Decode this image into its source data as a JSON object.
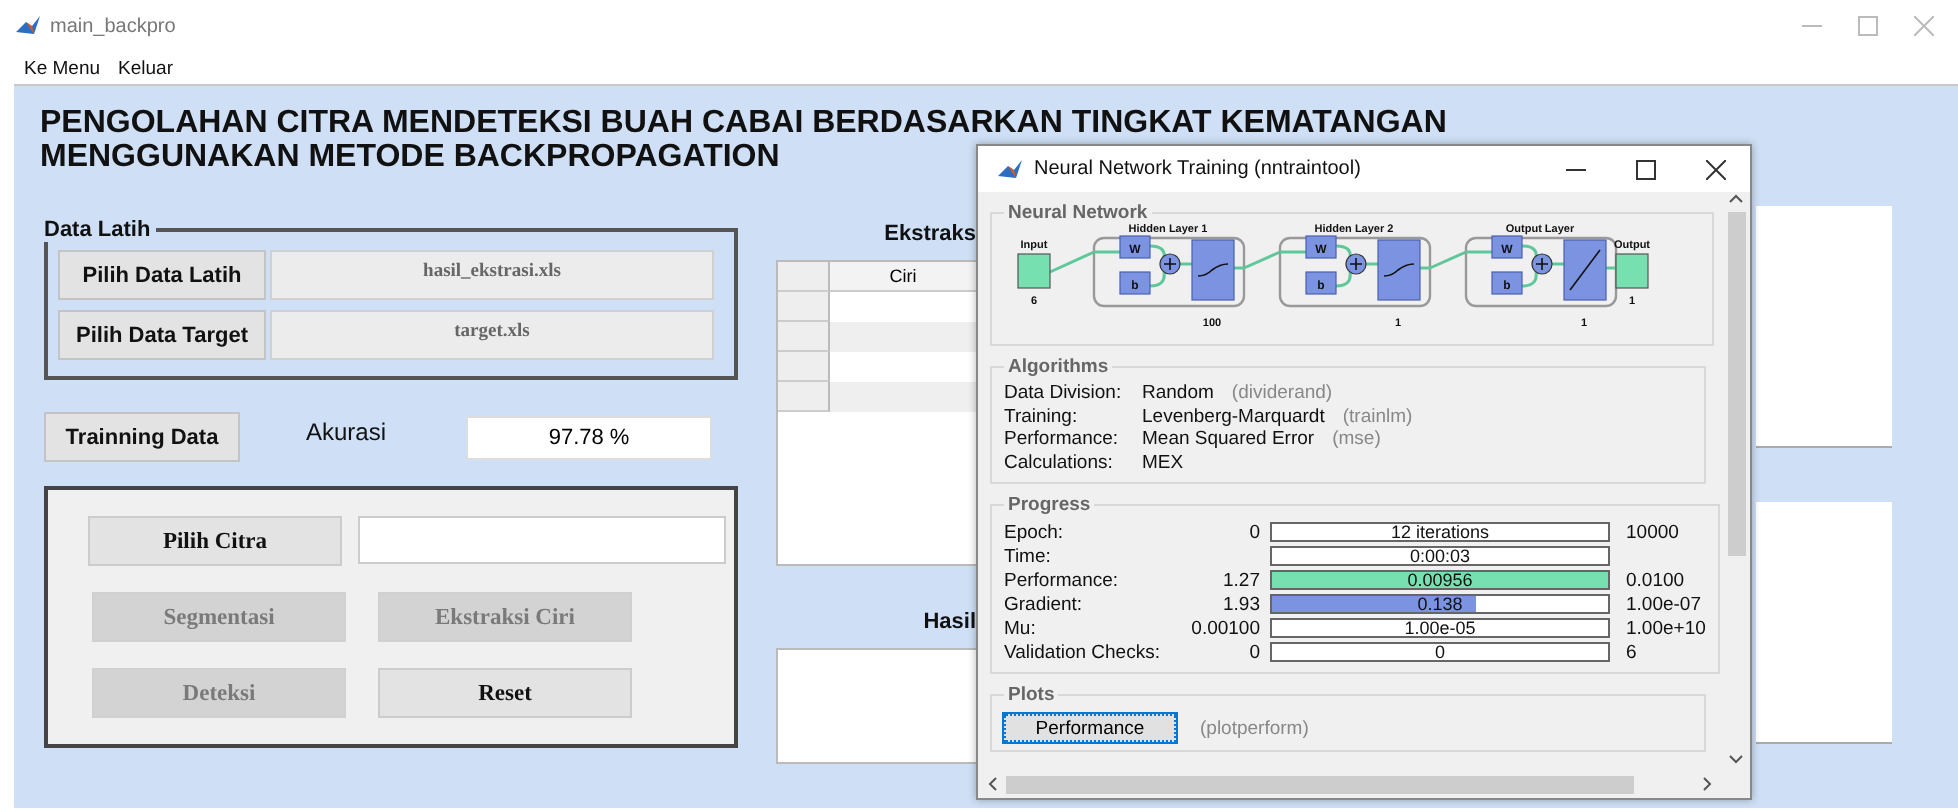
{
  "window": {
    "title": "main_backpro"
  },
  "menu": [
    "Ke Menu",
    "Keluar"
  ],
  "heading_lines": [
    "PENGOLAHAN CITRA MENDETEKSI BUAH CABAI BERDASARKAN TINGKAT KEMATANGAN",
    "MENGGUNAKAN METODE BACKPROPAGATION"
  ],
  "data_latih": {
    "title": "Data Latih",
    "rows": [
      {
        "button": "Pilih Data Latih",
        "value": "hasil_ekstrasi.xls"
      },
      {
        "button": "Pilih Data Target",
        "value": "target.xls"
      }
    ]
  },
  "training": {
    "button": "Trainning Data",
    "label": "Akurasi",
    "value": "97.78 %"
  },
  "image_panel": {
    "button": "Pilih Citra",
    "actions": [
      {
        "label": "Segmentasi",
        "disabled": true
      },
      {
        "label": "Ekstraksi Ciri",
        "disabled": true
      },
      {
        "label": "Deteksi",
        "disabled": true
      },
      {
        "label": "Reset",
        "disabled": false
      }
    ]
  },
  "feature_table": {
    "title": "Ekstraks",
    "columns": [
      "Ciri"
    ]
  },
  "result": {
    "title": "Hasil"
  },
  "dialog": {
    "title": "Neural Network Training (nntraintool)",
    "network": {
      "title": "Neural Network",
      "input": {
        "label": "Input",
        "size": "6"
      },
      "output": {
        "label": "Output",
        "size": "1"
      },
      "layers": [
        {
          "title": "Hidden Layer 1",
          "size": "100",
          "weight": "W",
          "bias": "b",
          "kind": "sigmoid"
        },
        {
          "title": "Hidden Layer 2",
          "size": "1",
          "weight": "W",
          "bias": "b",
          "kind": "sigmoid"
        },
        {
          "title": "Output Layer",
          "size": "1",
          "weight": "W",
          "bias": "b",
          "kind": "linear"
        }
      ]
    },
    "algorithms": {
      "title": "Algorithms",
      "rows": [
        {
          "label": "Data Division:",
          "value": "Random",
          "fn": "(dividerand)"
        },
        {
          "label": "Training:",
          "value": "Levenberg-Marquardt",
          "fn": "(trainlm)"
        },
        {
          "label": "Performance:",
          "value": "Mean Squared Error",
          "fn": "(mse)"
        },
        {
          "label": "Calculations:",
          "value": "MEX"
        }
      ]
    },
    "progress": {
      "title": "Progress",
      "rows": [
        {
          "label": "Epoch:",
          "start": "0",
          "bar": "12 iterations",
          "end": "10000"
        },
        {
          "label": "Time:",
          "bar": "0:00:03"
        },
        {
          "label": "Performance:",
          "start": "1.27",
          "bar": "0.00956",
          "end": "0.0100",
          "level": 1,
          "color": "#77e0b0"
        },
        {
          "label": "Gradient:",
          "start": "1.93",
          "bar": "0.138",
          "end": "1.00e-07",
          "level": 0.61,
          "color": "#7b93e0"
        },
        {
          "label": "Mu:",
          "start": "0.00100",
          "bar": "1.00e-05",
          "end": "1.00e+10"
        },
        {
          "label": "Validation Checks:",
          "start": "0",
          "bar": "0",
          "end": "6"
        }
      ]
    },
    "plots": {
      "title": "Plots",
      "button": "Performance",
      "fn": "(plotperform)"
    }
  }
}
